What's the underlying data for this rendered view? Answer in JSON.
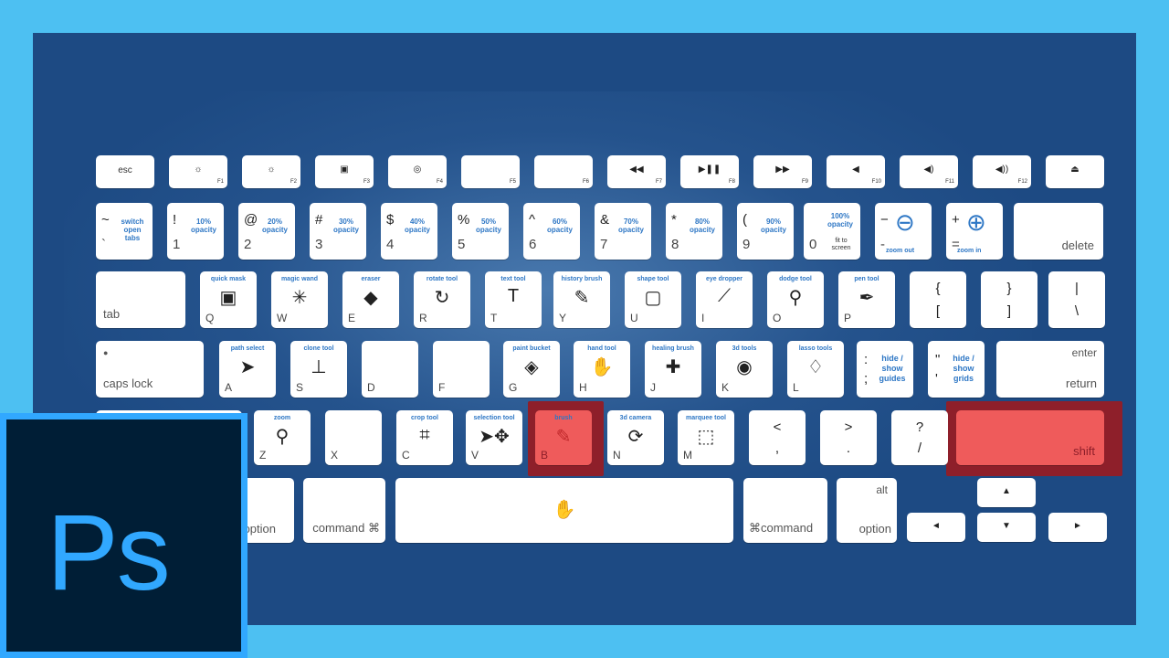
{
  "fn_row": [
    {
      "label": "esc"
    },
    {
      "icon": "☼",
      "fn": "F1",
      "icon_name": "brightness-down-icon"
    },
    {
      "icon": "☼",
      "fn": "F2",
      "icon_name": "brightness-up-icon"
    },
    {
      "icon": "▣",
      "fn": "F3",
      "icon_name": "mission-control-icon"
    },
    {
      "icon": "◎",
      "fn": "F4",
      "icon_name": "dashboard-icon"
    },
    {
      "icon": "",
      "fn": "F5"
    },
    {
      "icon": "",
      "fn": "F6"
    },
    {
      "icon": "◀◀",
      "fn": "F7",
      "icon_name": "rewind-icon"
    },
    {
      "icon": "▶❚❚",
      "fn": "F8",
      "icon_name": "play-pause-icon"
    },
    {
      "icon": "▶▶",
      "fn": "F9",
      "icon_name": "fast-forward-icon"
    },
    {
      "icon": "◀",
      "fn": "F10",
      "icon_name": "mute-icon"
    },
    {
      "icon": "◀)",
      "fn": "F11",
      "icon_name": "volume-down-icon"
    },
    {
      "icon": "◀))",
      "fn": "F12",
      "icon_name": "volume-up-icon"
    },
    {
      "icon": "⏏",
      "fn": "",
      "icon_name": "eject-icon"
    }
  ],
  "num_row": [
    {
      "top": "~",
      "bottom": "`",
      "desc": "switch open tabs"
    },
    {
      "top": "!",
      "bottom": "1",
      "desc": "10% opacity"
    },
    {
      "top": "@",
      "bottom": "2",
      "desc": "20% opacity"
    },
    {
      "top": "#",
      "bottom": "3",
      "desc": "30% opacity"
    },
    {
      "top": "$",
      "bottom": "4",
      "desc": "40% opacity"
    },
    {
      "top": "%",
      "bottom": "5",
      "desc": "50% opacity"
    },
    {
      "top": "^",
      "bottom": "6",
      "desc": "60% opacity"
    },
    {
      "top": "&",
      "bottom": "7",
      "desc": "70% opacity"
    },
    {
      "top": "*",
      "bottom": "8",
      "desc": "80% opacity"
    },
    {
      "top": "(",
      "bottom": "9",
      "desc": "90% opacity"
    },
    {
      "top": "",
      "bottom": "0",
      "desc": "100% opacity",
      "desc2": "fit to screen"
    },
    {
      "top": "−",
      "bottom": "-",
      "desc": "zoom out",
      "icon": "⊖",
      "icon_name": "zoom-out-icon"
    },
    {
      "top": "+",
      "bottom": "=",
      "desc": "zoom in",
      "icon": "⊕",
      "icon_name": "zoom-in-icon"
    },
    {
      "label": "delete"
    }
  ],
  "q_row": [
    {
      "label": "tab"
    },
    {
      "letter": "Q",
      "caption": "quick mask",
      "icon": "▣",
      "icon_name": "quick-mask-icon"
    },
    {
      "letter": "W",
      "caption": "magic wand",
      "icon": "✳",
      "icon_name": "magic-wand-icon"
    },
    {
      "letter": "E",
      "caption": "eraser",
      "icon": "◆",
      "icon_name": "eraser-icon"
    },
    {
      "letter": "R",
      "caption": "rotate tool",
      "icon": "↻",
      "icon_name": "rotate-view-icon"
    },
    {
      "letter": "T",
      "caption": "text tool",
      "icon": "T",
      "icon_name": "text-tool-icon"
    },
    {
      "letter": "Y",
      "caption": "history brush",
      "icon": "✎",
      "icon_name": "history-brush-icon"
    },
    {
      "letter": "U",
      "caption": "shape tool",
      "icon": "▢",
      "icon_name": "shape-tool-icon"
    },
    {
      "letter": "I",
      "caption": "eye dropper",
      "icon": "⟋",
      "icon_name": "eyedropper-icon"
    },
    {
      "letter": "O",
      "caption": "dodge tool",
      "icon": "⚲",
      "icon_name": "dodge-tool-icon"
    },
    {
      "letter": "P",
      "caption": "pen tool",
      "icon": "✒",
      "icon_name": "pen-tool-icon"
    },
    {
      "top": "{",
      "bottom": "["
    },
    {
      "top": "}",
      "bottom": "]"
    },
    {
      "top": "|",
      "bottom": "\\"
    }
  ],
  "a_row": [
    {
      "label": "caps lock",
      "dot": "●"
    },
    {
      "letter": "A",
      "caption": "path select",
      "icon": "➤",
      "icon_name": "path-select-icon"
    },
    {
      "letter": "S",
      "caption": "clone tool",
      "icon": "⊥",
      "icon_name": "clone-stamp-icon"
    },
    {
      "letter": "D"
    },
    {
      "letter": "F"
    },
    {
      "letter": "G",
      "caption": "paint bucket",
      "icon": "◈",
      "icon_name": "paint-bucket-icon"
    },
    {
      "letter": "H",
      "caption": "hand tool",
      "icon": "✋",
      "icon_name": "hand-tool-icon"
    },
    {
      "letter": "J",
      "caption": "healing brush",
      "icon": "✚",
      "icon_name": "healing-brush-icon"
    },
    {
      "letter": "K",
      "caption": "3d tools",
      "icon": "◉",
      "icon_name": "3d-tools-icon"
    },
    {
      "letter": "L",
      "caption": "lasso tools",
      "icon": "♢",
      "icon_name": "lasso-tool-icon"
    },
    {
      "top": ":",
      "bottom": ";",
      "desc": "hide / show guides"
    },
    {
      "top": "\"",
      "bottom": "'",
      "desc": "hide / show grids"
    },
    {
      "label_top": "enter",
      "label": "return"
    }
  ],
  "z_row": [
    {
      "letter": "Z",
      "caption": "zoom",
      "icon": "⚲",
      "icon_name": "zoom-tool-icon"
    },
    {
      "letter": "X"
    },
    {
      "letter": "C",
      "caption": "crop tool",
      "icon": "⌗",
      "icon_name": "crop-tool-icon"
    },
    {
      "letter": "V",
      "caption": "selection tool",
      "icon": "➤✥",
      "icon_name": "move-tool-icon"
    },
    {
      "letter": "B",
      "caption": "brush",
      "icon": "✎",
      "icon_name": "brush-icon",
      "highlight": true
    },
    {
      "letter": "N",
      "caption": "3d camera",
      "icon": "⟳",
      "icon_name": "3d-camera-icon"
    },
    {
      "letter": "M",
      "caption": "marquee tool",
      "icon": "⬚",
      "icon_name": "marquee-tool-icon"
    },
    {
      "top": "<",
      "bottom": ","
    },
    {
      "top": ">",
      "bottom": "."
    },
    {
      "top": "?",
      "bottom": "/"
    },
    {
      "label": "shift",
      "highlight": true
    }
  ],
  "bottom_row": {
    "option_left": "option",
    "command_left": "command ⌘",
    "space_icon": "✋",
    "command_right": "⌘command",
    "alt": "alt",
    "option_right": "option",
    "arrow_up": "▲",
    "arrow_left": "◄",
    "arrow_down": "▼",
    "arrow_right": "►"
  },
  "logo": {
    "text": "Ps"
  },
  "colors": {
    "background": "#4dc0f2",
    "keyboard_bg": "#1d4a83",
    "highlight_key": "#ef5b5b",
    "highlight_border": "#8e1f2a",
    "caption_blue": "#2e77c5",
    "logo_bg": "#001e36",
    "logo_accent": "#31a8ff"
  }
}
